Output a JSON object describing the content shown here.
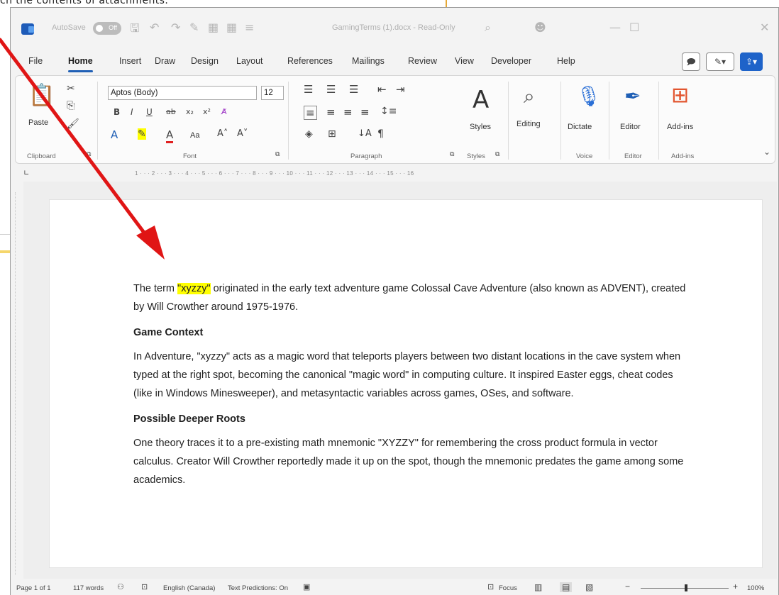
{
  "background": {
    "caption": "ch the contents of attachments."
  },
  "titlebar": {
    "autosave_label": "AutoSave",
    "autosave_state": "Off",
    "doc_title": "GamingTerms (1).docx  -  Read-Only",
    "search_glyph": "⌕",
    "minimize": "—",
    "maximize": "☐",
    "close": "✕"
  },
  "menu": {
    "tabs": [
      "File",
      "Home",
      "Insert",
      "Draw",
      "Design",
      "Layout",
      "References",
      "Mailings",
      "Review",
      "View",
      "Developer",
      "Help"
    ],
    "active": "Home"
  },
  "ribbon": {
    "clipboard": {
      "paste": "Paste",
      "label": "Clipboard"
    },
    "font": {
      "name": "Aptos (Body)",
      "size": "12",
      "label": "Font",
      "case": "Aa"
    },
    "paragraph": {
      "label": "Paragraph"
    },
    "styles": {
      "button": "Styles",
      "label": "Styles"
    },
    "editing": {
      "button": "Editing"
    },
    "voice": {
      "button": "Dictate",
      "label": "Voice"
    },
    "editor": {
      "button": "Editor",
      "label": "Editor"
    },
    "addins": {
      "button": "Add-ins",
      "label": "Add-ins"
    }
  },
  "ruler": {
    "numbers": "1 · · · 2 · · · 3 · · · 4 · · · 5 · · · 6 · · · 7 · · · 8 · · · 9 · · · 10 · · · 11 · · · 12 · · · 13 · · · 14 · · · 15 · · · 16"
  },
  "document": {
    "p1_before": "The term ",
    "p1_highlight": "\"xyzzy\"",
    "p1_after": " originated in the early text adventure game Colossal Cave Adventure (also known as ADVENT), created by Will Crowther around 1975-1976.",
    "h1": "Game Context",
    "p2": "In Adventure, \"xyzzy\" acts as a magic word that teleports players between two distant locations in the cave system when typed at the right spot, becoming the canonical \"magic word\" in computing culture. It inspired Easter eggs, cheat codes (like in Windows Minesweeper), and metasyntactic variables across games, OSes, and software.",
    "h2": "Possible Deeper Roots",
    "p3": "One theory traces it to a pre-existing math mnemonic \"XYZZY\" for remembering the cross product formula in vector calculus. Creator Will Crowther reportedly made it up on the spot, though the mnemonic predates the game among some academics."
  },
  "status": {
    "page": "Page 1 of 1",
    "words": "117 words",
    "language": "English (Canada)",
    "predictions": "Text Predictions: On",
    "focus": "Focus",
    "zoom": "100%"
  },
  "colors": {
    "annotation_arrow": "#e01515",
    "highlight": "#ffff00",
    "accent": "#1f5fb5"
  }
}
